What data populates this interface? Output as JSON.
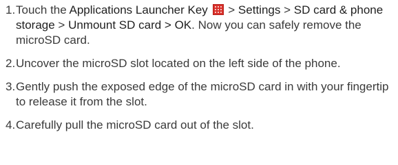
{
  "steps": [
    {
      "num": "1.",
      "parts": {
        "t1": "Touch the ",
        "b1": "Applications Launcher Key",
        "t2": " > ",
        "b2": "Settings",
        "t3": " > ",
        "b3": "SD card & phone storage",
        "t4": " > ",
        "b4": "Unmount SD card > OK",
        "t5": ". Now you can safely remove the microSD card."
      },
      "icon": "applications-launcher-icon"
    },
    {
      "num": "2.",
      "text": "Uncover the microSD slot located on the left side of the phone."
    },
    {
      "num": "3.",
      "text": "Gently push the exposed edge of the microSD card in with your fingertip to release it from the slot."
    },
    {
      "num": "4.",
      "text": "Carefully pull the microSD card out of the slot."
    }
  ],
  "colors": {
    "text": "#3a3a3a",
    "icon_red": "#d9302a"
  }
}
